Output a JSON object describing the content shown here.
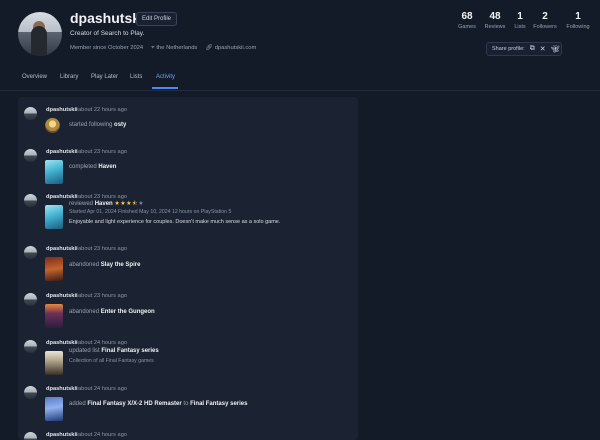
{
  "profile": {
    "username": "dpashutskii",
    "edit_label": "Edit Profile",
    "tagline": "Creator of Search to Play.",
    "member_since": "Member since October 2024",
    "location": "the Netherlands",
    "website": "dpashutskii.com"
  },
  "stats": [
    {
      "num": "68",
      "label": "Games"
    },
    {
      "num": "48",
      "label": "Reviews"
    },
    {
      "num": "1",
      "label": "Lists"
    },
    {
      "num": "2",
      "label": "Followers"
    },
    {
      "num": "1",
      "label": "Following"
    }
  ],
  "share": {
    "label": "Share profile:"
  },
  "tabs": [
    "Overview",
    "Library",
    "Play Later",
    "Lists",
    "Activity"
  ],
  "active_tab": "Activity",
  "colors": {
    "accent": "#4f86f7",
    "star": "#f2c94c",
    "bg": "#131a28",
    "card": "#1b2332"
  },
  "feed": [
    {
      "user": "dpashutskii",
      "time": "about 22 hours ago",
      "verb": "started following",
      "target": "osty"
    },
    {
      "user": "dpashutskii",
      "time": "about 23 hours ago",
      "verb": "completed",
      "target": "Haven"
    },
    {
      "user": "dpashutskii",
      "time": "about 23 hours ago",
      "verb": "reviewed",
      "target": "Haven",
      "rating": 3.5,
      "details": "Started Apr 01, 2024   Finished May 10, 2024   12 hours on PlayStation 5",
      "review": "Enjoyable and light experience for couples. Doesn't make much sense as a solo game."
    },
    {
      "user": "dpashutskii",
      "time": "about 23 hours ago",
      "verb": "abandoned",
      "target": "Slay the Spire"
    },
    {
      "user": "dpashutskii",
      "time": "about 23 hours ago",
      "verb": "abandoned",
      "target": "Enter the Gungeon"
    },
    {
      "user": "dpashutskii",
      "time": "about 24 hours ago",
      "verb": "updated list",
      "target": "Final Fantasy series",
      "sub": "Collection of all Final Fantasy games"
    },
    {
      "user": "dpashutskii",
      "time": "about 24 hours ago",
      "verb": "added",
      "target": "Final Fantasy X/X-2 HD Remaster",
      "joiner": "to",
      "target2": "Final Fantasy series"
    },
    {
      "user": "dpashutskii",
      "time": "about 24 hours ago"
    }
  ]
}
